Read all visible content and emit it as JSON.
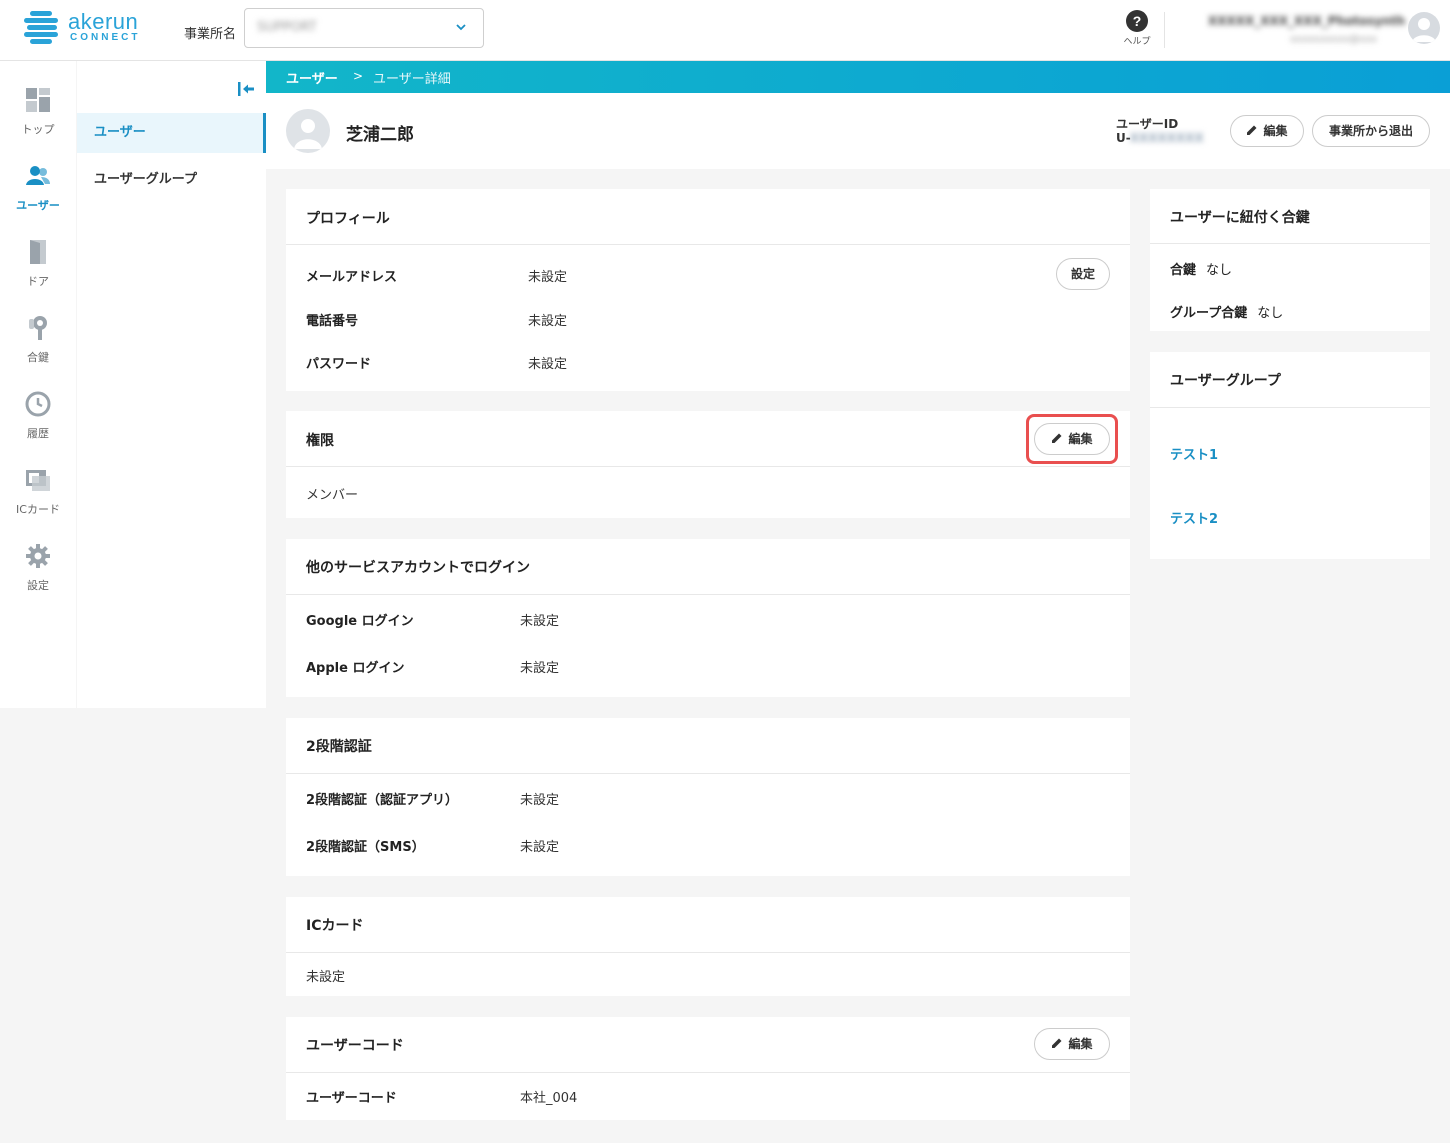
{
  "header": {
    "logo_word": "akerun",
    "logo_sub": "CONNECT",
    "business_label": "事業所名",
    "business_value": "SUPPORT",
    "help_label": "ヘルプ",
    "help_glyph": "?",
    "account_name": "XXXXX_XXX_XXX_Photosynth",
    "account_sub": "xxxxxxxxxx@xxx"
  },
  "rail": [
    {
      "label": "トップ",
      "icon": "dashboard-icon"
    },
    {
      "label": "ユーザー",
      "icon": "users-icon"
    },
    {
      "label": "ドア",
      "icon": "door-icon"
    },
    {
      "label": "合鍵",
      "icon": "key-icon"
    },
    {
      "label": "履歴",
      "icon": "history-icon"
    },
    {
      "label": "ICカード",
      "icon": "ic-card-icon"
    },
    {
      "label": "設定",
      "icon": "gear-icon"
    }
  ],
  "subnav": {
    "items": [
      {
        "label": "ユーザー"
      },
      {
        "label": "ユーザーグループ"
      }
    ]
  },
  "breadcrumb": {
    "root": "ユーザー",
    "separator": ">",
    "current": "ユーザー詳細"
  },
  "user": {
    "name": "芝浦二郎",
    "id_label": "ユーザーID",
    "id_prefix": "U-",
    "id_value": "XXXXXXXX",
    "edit_label": "編集",
    "leave_label": "事業所から退出"
  },
  "profile": {
    "title": "プロフィール",
    "set_label": "設定",
    "rows": [
      {
        "key": "メールアドレス",
        "value": "未設定"
      },
      {
        "key": "電話番号",
        "value": "未設定"
      },
      {
        "key": "パスワード",
        "value": "未設定"
      }
    ]
  },
  "permission": {
    "title": "権限",
    "edit_label": "編集",
    "value": "メンバー"
  },
  "sso": {
    "title": "他のサービスアカウントでログイン",
    "rows": [
      {
        "key": "Google ログイン",
        "value": "未設定"
      },
      {
        "key": "Apple ログイン",
        "value": "未設定"
      }
    ]
  },
  "twofa": {
    "title": "2段階認証",
    "rows": [
      {
        "key": "2段階認証（認証アプリ）",
        "value": "未設定"
      },
      {
        "key": "2段階認証（SMS）",
        "value": "未設定"
      }
    ]
  },
  "iccard": {
    "title": "ICカード",
    "value": "未設定"
  },
  "usercode": {
    "title": "ユーザーコード",
    "edit_label": "編集",
    "key": "ユーザーコード",
    "value": "本社_004"
  },
  "keys": {
    "title": "ユーザーに紐付く合鍵",
    "rows": [
      {
        "key": "合鍵",
        "value": "なし"
      },
      {
        "key": "グループ合鍵",
        "value": "なし"
      }
    ]
  },
  "groups": {
    "title": "ユーザーグループ",
    "items": [
      "テスト1",
      "テスト2"
    ]
  },
  "colors": {
    "accent": "#1a8fc4",
    "highlight": "#e94f4f",
    "gradient_start": "#12b6c9",
    "gradient_end": "#0a9fd6"
  }
}
